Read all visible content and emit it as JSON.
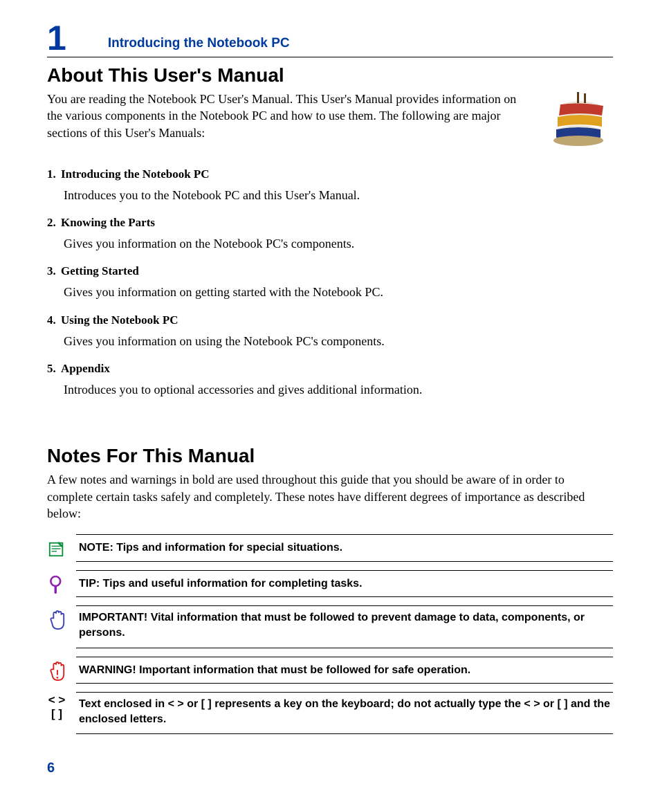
{
  "chapter": {
    "number": "1",
    "title": "Introducing the Notebook PC"
  },
  "about": {
    "heading": "About This User's Manual",
    "intro": "You are reading the Notebook PC User's Manual. This User's Manual provides information on the various components in the Notebook PC and how to use them. The following are major sections of this User's Manuals:",
    "items": [
      {
        "num": "1.",
        "title": "Introducing the Notebook PC",
        "desc": "Introduces you to the Notebook PC and this User's Manual."
      },
      {
        "num": "2.",
        "title": "Knowing the Parts",
        "desc": "Gives you information on the Notebook PC's components."
      },
      {
        "num": "3.",
        "title": "Getting Started",
        "desc": "Gives you information on getting started with the Notebook PC."
      },
      {
        "num": "4.",
        "title": "Using the Notebook PC",
        "desc": "Gives you information on using the Notebook PC's components."
      },
      {
        "num": "5.",
        "title": "Appendix",
        "desc": "Introduces you to optional accessories and gives additional information."
      }
    ]
  },
  "notes": {
    "heading": "Notes For This Manual",
    "intro": "A few notes and warnings in bold are used throughout this guide that you should be aware of in order to complete certain tasks safely and completely. These notes have different degrees of importance as described below:",
    "note": "NOTE: Tips and information for special situations.",
    "tip": "TIP: Tips and useful information for completing tasks.",
    "important": "IMPORTANT! Vital information that must be followed to prevent damage to data, components, or persons.",
    "warning": "WARNING! Important information that must be followed for safe operation.",
    "keys_sym1": "< >",
    "keys_sym2": "[  ]",
    "keys": "Text enclosed in < > or [ ] represents a key on the keyboard; do not actually type the < > or [ ] and the enclosed letters."
  },
  "pageNumber": "6"
}
